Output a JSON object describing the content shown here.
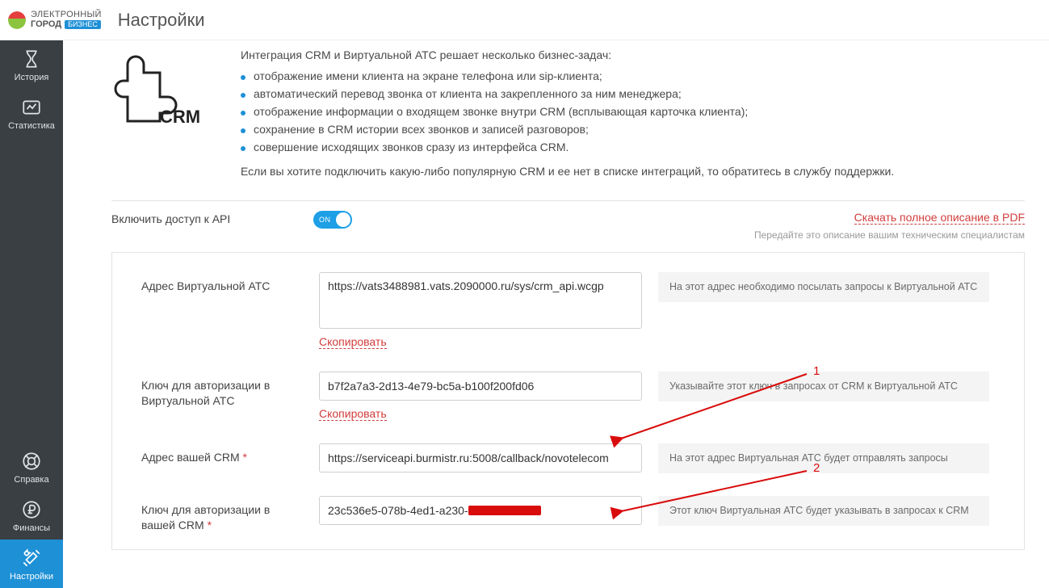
{
  "brand": {
    "line1": "ЭЛЕКТРОННЫЙ",
    "line2_city": "ГОРОД",
    "line2_badge": "БИЗНЕС"
  },
  "page_title": "Настройки",
  "sidebar": {
    "items": [
      {
        "label": "История"
      },
      {
        "label": "Статистика"
      },
      {
        "label": "Справка"
      },
      {
        "label": "Финансы"
      },
      {
        "label": "Настройки"
      }
    ]
  },
  "intro": {
    "lead": "Интеграция CRM и Виртуальной АТС решает несколько бизнес-задач:",
    "bullets": [
      "отображение имени клиента на экране телефона или sip-клиента;",
      "автоматический перевод звонка от клиента на закрепленного за ним менеджера;",
      "отображение информации о входящем звонке внутри CRM (всплывающая карточка клиента);",
      "сохранение в CRM истории всех звонков и записей разговоров;",
      "совершение исходящих звонков сразу из интерфейса CRM."
    ],
    "foot": "Если вы хотите подключить какую-либо популярную CRM и ее нет в списке интеграций, то обратитесь в службу поддержки."
  },
  "api_access": {
    "label": "Включить доступ к API",
    "toggle_state": "ON",
    "pdf_link": "Скачать полное описание в PDF",
    "pdf_sub": "Передайте это описание вашим техническим специалистам"
  },
  "form": {
    "rows": [
      {
        "label": "Адрес Виртуальной АТС",
        "value": "https://vats3488981.vats.2090000.ru/sys/crm_api.wcgp",
        "hint": "На этот адрес необходимо посылать запросы к Виртуальной АТС",
        "copy_text": "Скопировать",
        "multiline": true
      },
      {
        "label": "Ключ для авторизации в Виртуальной АТС",
        "value": "b7f2a7a3-2d13-4e79-bc5a-b100f200fd06",
        "hint": "Указывайте этот ключ в запросах от CRM к Виртуальной АТС",
        "copy_text": "Скопировать"
      },
      {
        "label": "Адрес вашей CRM",
        "required": true,
        "value": "https://serviceapi.burmistr.ru:5008/callback/novotelecom",
        "hint": "На этот адрес Виртуальная АТС будет отправлять запросы"
      },
      {
        "label": "Ключ для авторизации в вашей CRM",
        "required": true,
        "value_prefix": "23c536e5-078b-4ed1-a230-",
        "redacted": true,
        "hint": "Этот ключ Виртуальная АТС будет указывать в запросах к CRM"
      }
    ]
  },
  "annotations": {
    "num1": "1",
    "num2": "2"
  }
}
